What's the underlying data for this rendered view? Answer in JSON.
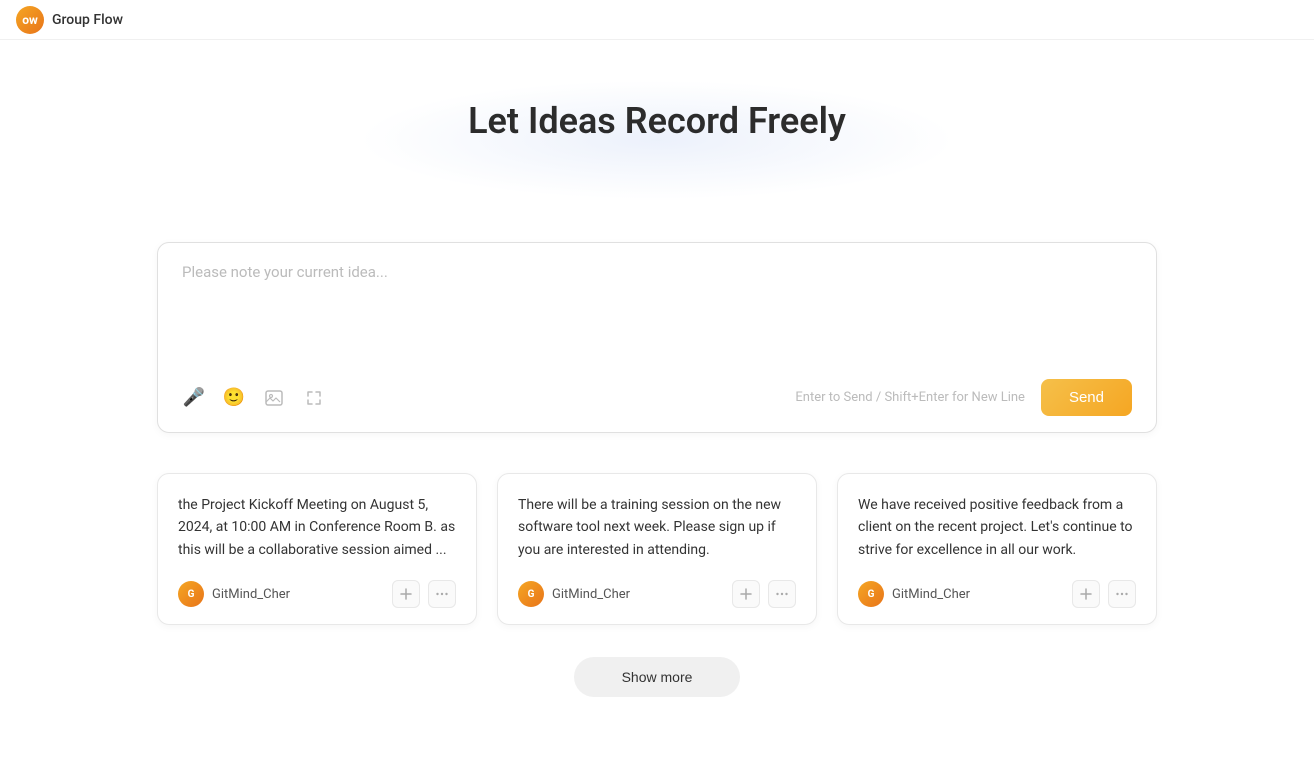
{
  "topBar": {
    "logoText": "ow",
    "title": "Group Flow"
  },
  "hero": {
    "title": "Let Ideas Record Freely",
    "bgGradient": true
  },
  "inputArea": {
    "placeholder": "Please note your current idea...",
    "shortcutHint": "Enter to Send / Shift+Enter for New Line",
    "sendLabel": "Send",
    "icons": [
      {
        "name": "microphone-icon",
        "symbol": "🎤"
      },
      {
        "name": "emoji-icon",
        "symbol": "😊"
      },
      {
        "name": "image-icon",
        "symbol": "🖼"
      },
      {
        "name": "expand-icon",
        "symbol": "⤡"
      }
    ]
  },
  "cards": [
    {
      "id": 1,
      "content": "the Project Kickoff Meeting on August 5, 2024, at 10:00 AM in Conference Room B. as this will be a collaborative session aimed ...",
      "author": "GitMind_Cher",
      "avatarInitials": "G"
    },
    {
      "id": 2,
      "content": "There will be a training session on the new software tool next week. Please sign up if you are interested in attending.",
      "author": "GitMind_Cher",
      "avatarInitials": "G"
    },
    {
      "id": 3,
      "content": "We have received positive feedback from a client on the recent project. Let's continue to strive for excellence in all our work.",
      "author": "GitMind_Cher",
      "avatarInitials": "G"
    }
  ],
  "showMore": {
    "label": "Show more"
  }
}
